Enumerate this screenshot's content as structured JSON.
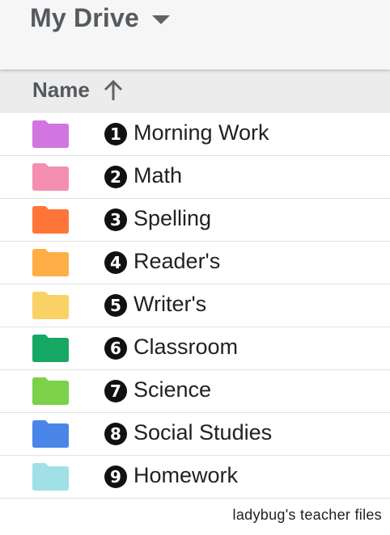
{
  "header": {
    "title": "My Drive",
    "dropdown_icon": "caret-down-icon"
  },
  "column_header": {
    "label": "Name",
    "sort_icon": "arrow-up-icon",
    "sort": "ascending"
  },
  "files": [
    {
      "number": "1",
      "name": "Morning Work",
      "type": "folder",
      "color": "#d175e0"
    },
    {
      "number": "2",
      "name": "Math",
      "type": "folder",
      "color": "#f48fb1"
    },
    {
      "number": "3",
      "name": "Spelling",
      "type": "folder",
      "color": "#ff7537"
    },
    {
      "number": "4",
      "name": "Reader's",
      "type": "folder",
      "color": "#ffad46"
    },
    {
      "number": "5",
      "name": "Writer's",
      "type": "folder",
      "color": "#fad165"
    },
    {
      "number": "6",
      "name": "Classroom",
      "type": "folder",
      "color": "#16a765"
    },
    {
      "number": "7",
      "name": "Science",
      "type": "folder",
      "color": "#7bd148"
    },
    {
      "number": "8",
      "name": "Social Studies",
      "type": "folder",
      "color": "#4a86e8"
    },
    {
      "number": "9",
      "name": "Homework",
      "type": "folder",
      "color": "#9fe1e7"
    }
  ],
  "watermark": "ladybug's teacher files"
}
